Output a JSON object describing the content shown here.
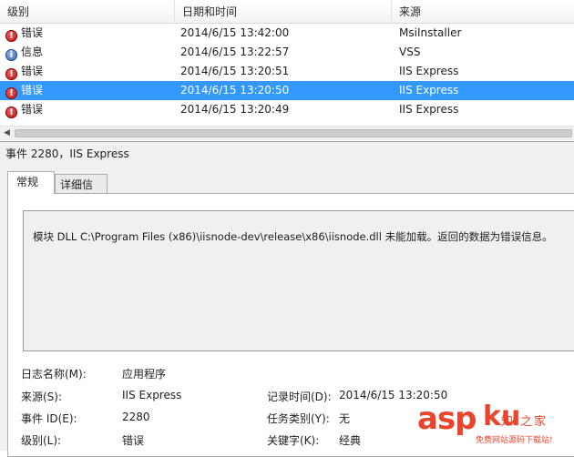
{
  "list": {
    "columns": [
      "级别",
      "日期和时间",
      "来源"
    ],
    "rows": [
      {
        "icon": "error-icon",
        "level": "错误",
        "date": "2014/6/15 13:42:00",
        "source": "MsiInstaller",
        "selected": false
      },
      {
        "icon": "info-icon",
        "level": "信息",
        "date": "2014/6/15 13:22:57",
        "source": "VSS",
        "selected": false
      },
      {
        "icon": "error-icon",
        "level": "错误",
        "date": "2014/6/15 13:20:51",
        "source": "IIS Express",
        "selected": false
      },
      {
        "icon": "error-icon",
        "level": "错误",
        "date": "2014/6/15 13:20:50",
        "source": "IIS Express",
        "selected": true
      },
      {
        "icon": "error-icon",
        "level": "错误",
        "date": "2014/6/15 13:20:49",
        "source": "IIS Express",
        "selected": false
      }
    ]
  },
  "detail": {
    "title": "事件 2280，IIS Express",
    "tabs": [
      "常规",
      "详细信息"
    ],
    "message": "模块 DLL C:\\Program Files (x86)\\iisnode-dev\\release\\x86\\iisnode.dll 未能加载。返回的数据为错误信息。",
    "properties": {
      "log_name_label": "日志名称(M):",
      "log_name_value": "应用程序",
      "source_label": "来源(S):",
      "source_value": "IIS Express",
      "logged_label": "记录时间(D):",
      "logged_value": "2014/6/15 13:20:50",
      "event_id_label": "事件 ID(E):",
      "event_id_value": "2280",
      "task_label": "任务类别(Y):",
      "task_value": "无",
      "level_label": "级别(L):",
      "level_value": "错误",
      "keywords_label": "关键字(K):",
      "keywords_value": "经典"
    }
  },
  "watermark": {
    "asp": "asp",
    "ku": "ku",
    "cn": "知 之家",
    "sub": "免费网站源码下载站!"
  },
  "colors": {
    "selection": "#3399ff",
    "error": "#c81a1a",
    "info": "#2c5ea8",
    "watermark": "#e8452c"
  }
}
